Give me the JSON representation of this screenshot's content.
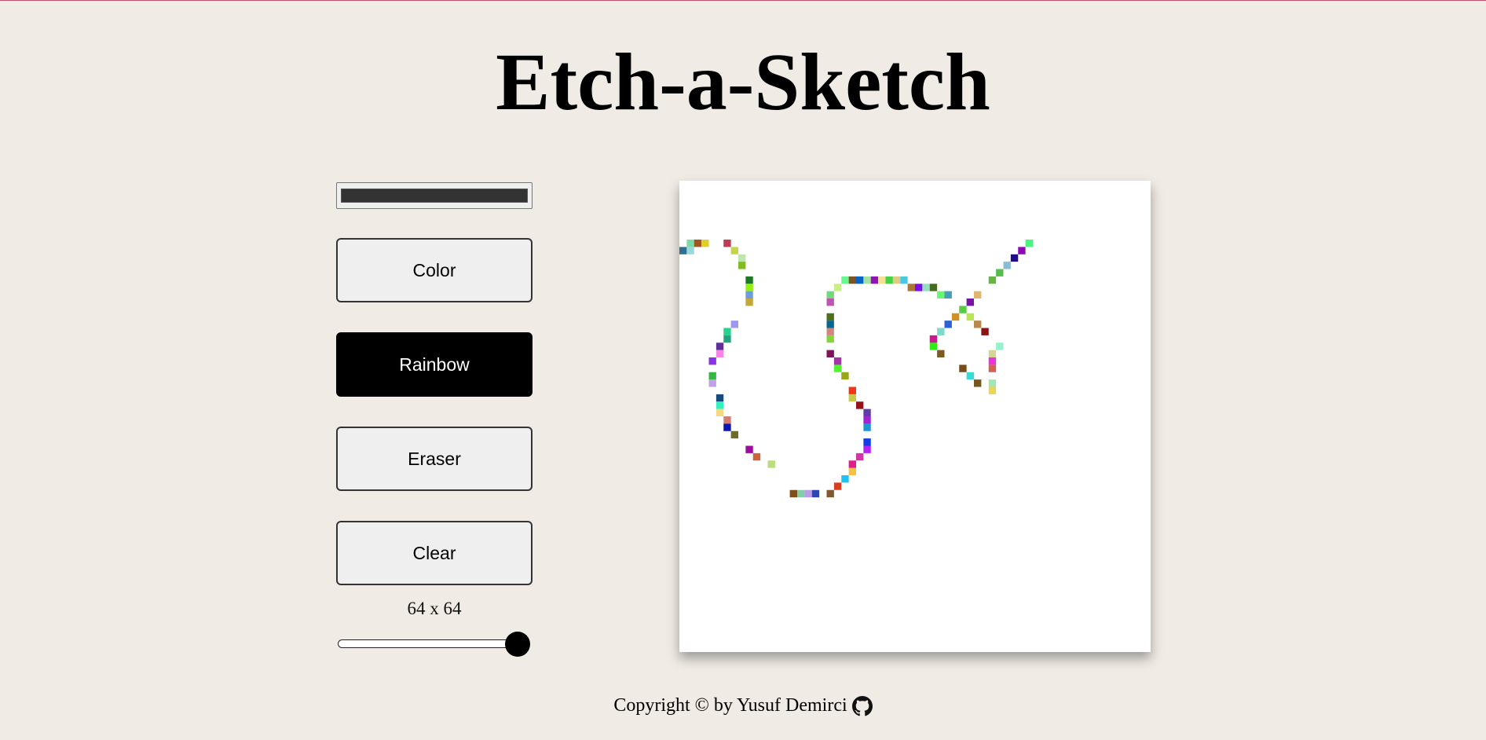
{
  "title": "Etch-a-Sketch",
  "color_picker": {
    "value": "#333333",
    "icon": "color-swatch"
  },
  "buttons": {
    "color": "Color",
    "rainbow": "Rainbow",
    "eraser": "Eraser",
    "clear": "Clear"
  },
  "active_mode": "rainbow",
  "grid": {
    "label": "64 x 64",
    "size": 64,
    "slider_min": 1,
    "slider_max": 64,
    "slider_value": 64
  },
  "footer": {
    "text": "Copyright © by Yusuf Demirci",
    "icon": "github-icon"
  },
  "colors": {
    "background": "#f0ebe4",
    "active_button": "#000000",
    "button": "#efefef",
    "canvas": "#ffffff"
  }
}
